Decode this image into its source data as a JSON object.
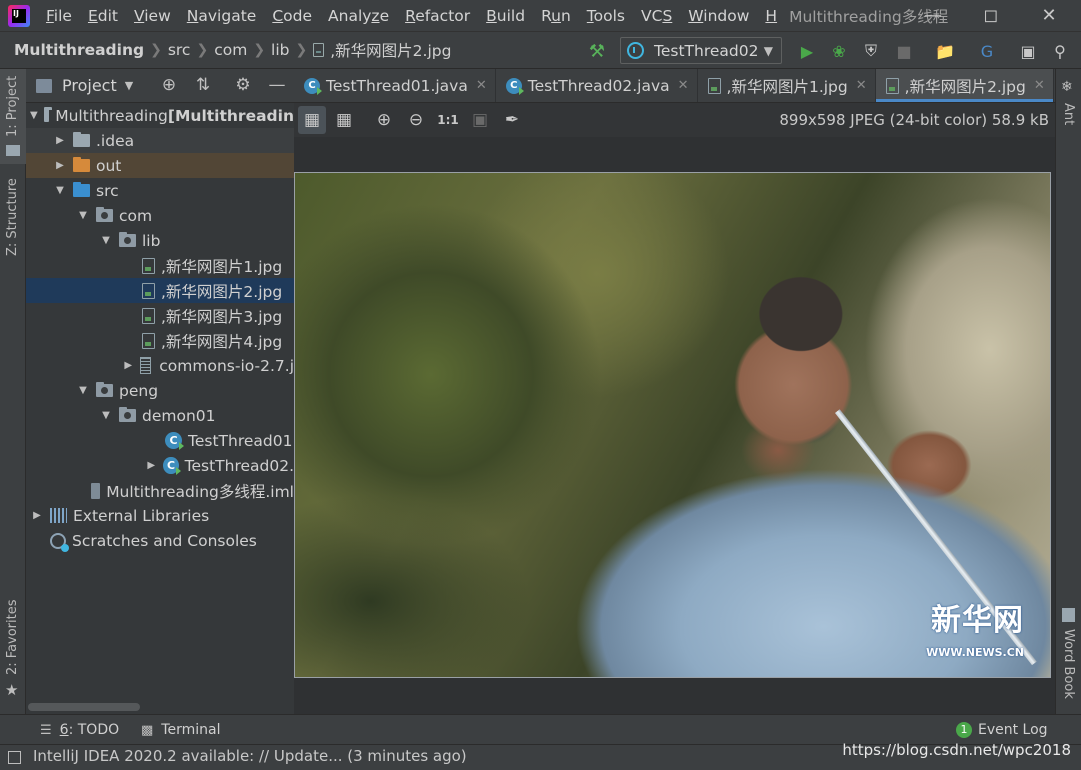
{
  "menubar": {
    "items": [
      {
        "pre": "",
        "mn": "F",
        "post": "ile"
      },
      {
        "pre": "",
        "mn": "E",
        "post": "dit"
      },
      {
        "pre": "",
        "mn": "V",
        "post": "iew"
      },
      {
        "pre": "",
        "mn": "N",
        "post": "avigate"
      },
      {
        "pre": "",
        "mn": "C",
        "post": "ode"
      },
      {
        "pre": "Analy",
        "mn": "z",
        "post": "e"
      },
      {
        "pre": "",
        "mn": "R",
        "post": "efactor"
      },
      {
        "pre": "",
        "mn": "B",
        "post": "uild"
      },
      {
        "pre": "R",
        "mn": "u",
        "post": "n"
      },
      {
        "pre": "",
        "mn": "T",
        "post": "ools"
      },
      {
        "pre": "VC",
        "mn": "S",
        "post": ""
      },
      {
        "pre": "",
        "mn": "W",
        "post": "indow"
      },
      {
        "pre": "",
        "mn": "H",
        "post": ""
      }
    ],
    "window_title": "Multithreading多线程",
    "logo_text": "IJ"
  },
  "navbar": {
    "crumbs": [
      "Multithreading",
      "src",
      "com",
      "lib",
      ",新华网图片2.jpg"
    ],
    "run_config": "TestThread02"
  },
  "project": {
    "title": "Project",
    "tree": [
      {
        "label": "Multithreading",
        "suffix": " [Multithreadin",
        "depth": 0,
        "icon": "module",
        "arrow": "down",
        "style": ""
      },
      {
        "label": ".idea",
        "depth": 1,
        "icon": "folder-grey",
        "arrow": "right",
        "style": "idea"
      },
      {
        "label": "out",
        "depth": 1,
        "icon": "folder-orange",
        "arrow": "right",
        "style": "out"
      },
      {
        "label": "src",
        "depth": 1,
        "icon": "folder-blue",
        "arrow": "down",
        "style": ""
      },
      {
        "label": "com",
        "depth": 2,
        "icon": "package",
        "arrow": "down",
        "style": ""
      },
      {
        "label": "lib",
        "depth": 3,
        "icon": "package",
        "arrow": "down",
        "style": ""
      },
      {
        "label": ",新华网图片1.jpg",
        "depth": 4,
        "icon": "image",
        "arrow": "",
        "style": ""
      },
      {
        "label": ",新华网图片2.jpg",
        "depth": 4,
        "icon": "image",
        "arrow": "",
        "style": "selected"
      },
      {
        "label": ",新华网图片3.jpg",
        "depth": 4,
        "icon": "image",
        "arrow": "",
        "style": ""
      },
      {
        "label": ",新华网图片4.jpg",
        "depth": 4,
        "icon": "image",
        "arrow": "",
        "style": ""
      },
      {
        "label": "commons-io-2.7.j",
        "depth": 4,
        "icon": "jar",
        "arrow": "right",
        "style": ""
      },
      {
        "label": "peng",
        "depth": 2,
        "icon": "package",
        "arrow": "down",
        "style": ""
      },
      {
        "label": "demon01",
        "depth": 3,
        "icon": "package",
        "arrow": "down",
        "style": ""
      },
      {
        "label": "TestThread01",
        "depth": 5,
        "icon": "class",
        "arrow": "",
        "style": ""
      },
      {
        "label": "TestThread02.",
        "depth": 5,
        "icon": "class",
        "arrow": "right",
        "style": ""
      },
      {
        "label": "Multithreading多线程.iml",
        "depth": 2,
        "icon": "iml",
        "arrow": "",
        "style": ""
      },
      {
        "label": "External Libraries",
        "depth": 0,
        "icon": "library",
        "arrow": "right",
        "style": ""
      },
      {
        "label": "Scratches and Consoles",
        "depth": 0,
        "icon": "scratch",
        "arrow": "",
        "style": ""
      }
    ]
  },
  "tabs": [
    {
      "label": "TestThread01.java",
      "icon": "class",
      "active": false
    },
    {
      "label": "TestThread02.java",
      "icon": "class",
      "active": false
    },
    {
      "label": ",新华网图片1.jpg",
      "icon": "image",
      "active": false
    },
    {
      "label": ",新华网图片2.jpg",
      "icon": "image",
      "active": true
    }
  ],
  "image_editor": {
    "info": "899x598 JPEG (24-bit color) 58.9 kB",
    "actual_size_label": "1:1",
    "watermark_logo": "新华网",
    "watermark_url": "WWW.NEWS.CN"
  },
  "left_strip": {
    "project": "1: Project",
    "structure": "Z: Structure",
    "favorites": "2: Favorites"
  },
  "right_strip": {
    "ant": "Ant",
    "wordbook": "Word Book"
  },
  "bottom": {
    "todo_mn": "6",
    "todo_rest": ": TODO",
    "terminal": "Terminal",
    "event_count": "1",
    "event_log": "Event Log"
  },
  "status": {
    "text": "IntelliJ IDEA 2020.2 available: // Update... (3 minutes ago)",
    "overlay": "https://blog.csdn.net/wpc2018"
  }
}
